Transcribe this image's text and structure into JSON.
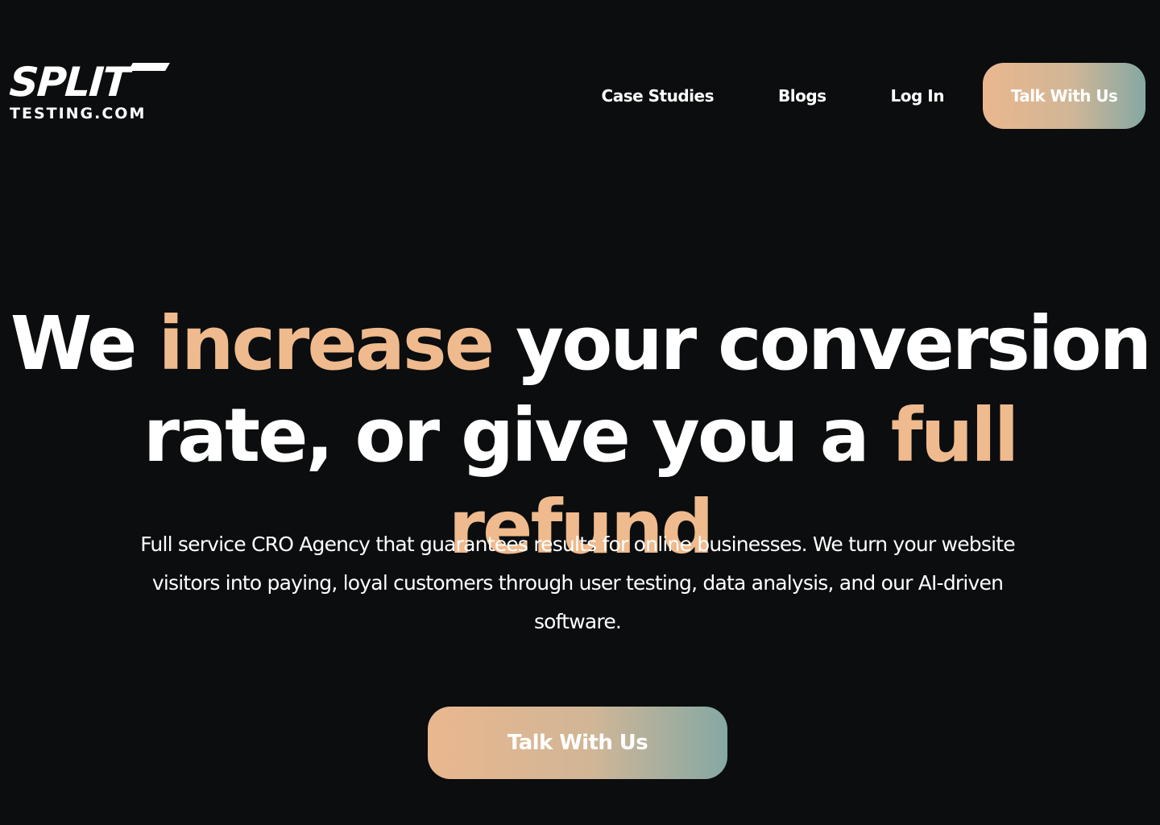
{
  "logo": {
    "line1": "SPLIT",
    "line2": "TESTING.COM"
  },
  "nav": {
    "links": [
      {
        "label": "Case Studies"
      },
      {
        "label": "Blogs"
      },
      {
        "label": "Log In"
      }
    ],
    "cta_label": "Talk With Us"
  },
  "hero": {
    "title": {
      "part1": "We ",
      "accent1": "increase",
      "part2": " your conversion rate, or give you a ",
      "accent2": "full refund"
    },
    "subtitle": "Full service CRO Agency that guarantees results for online businesses. We turn your website visitors into paying, loyal customers through user testing, data analysis, and our AI-driven software.",
    "cta_label": "Talk With Us"
  },
  "colors": {
    "background": "#0b0d0e",
    "accent": "#efba8d",
    "gradient_start": "#eab78e",
    "gradient_end": "#85a8a3"
  }
}
